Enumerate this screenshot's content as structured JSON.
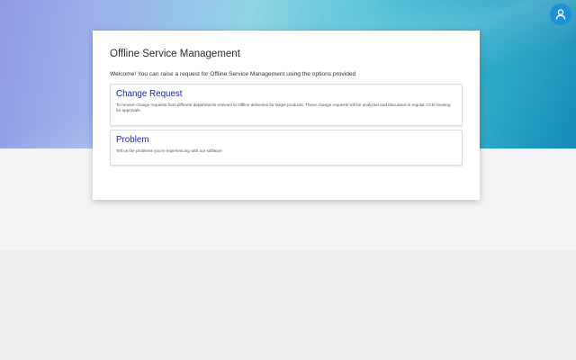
{
  "header": {
    "avatar_icon": "user-icon",
    "accent_color": "#1f8fd6"
  },
  "portal": {
    "title": "Offline Service Management",
    "intro": "Welcome! You can raise a request for Offline Service Management using the options provided",
    "options": [
      {
        "title": "Change Request",
        "description": "To receive change requests from different departments relevant to Offline deliveries for target products. These change requests will be analyzed and discussed in regular CCB meeting for approvals."
      },
      {
        "title": "Problem",
        "description": "Tell us the problems you're experiencing with our software"
      }
    ]
  }
}
